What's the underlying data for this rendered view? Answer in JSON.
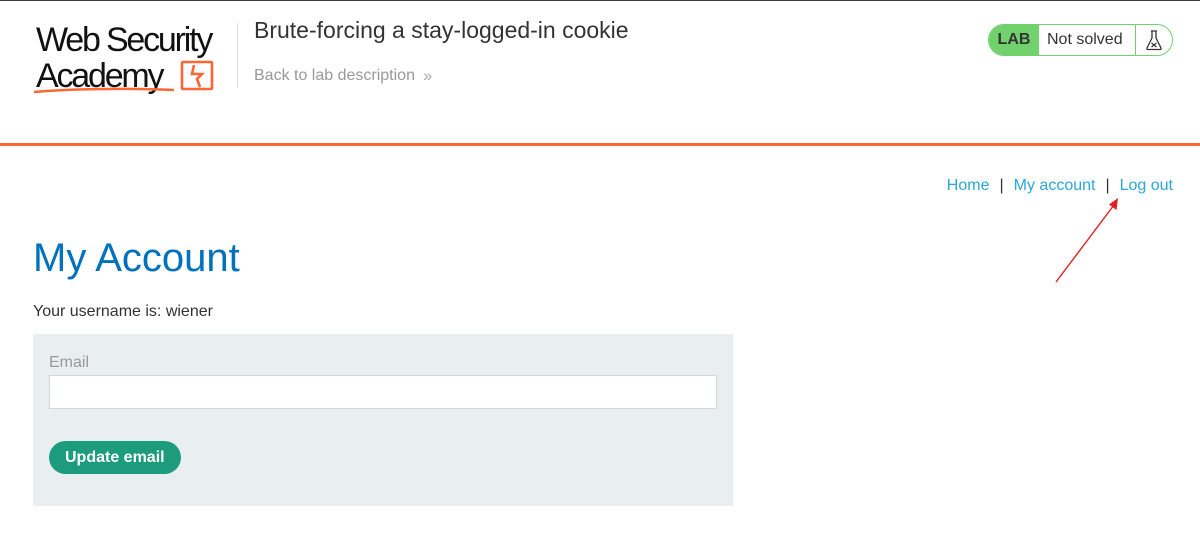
{
  "logo": {
    "line1": "Web Security",
    "line2": "Academy"
  },
  "lab": {
    "title": "Brute-forcing a stay-logged-in cookie",
    "back_link_label": "Back to lab description",
    "back_link_icon": "double-chevron-right-icon"
  },
  "status": {
    "badge": "LAB",
    "text": "Not solved",
    "icon": "flask-icon"
  },
  "nav": {
    "home": "Home",
    "separator": "|",
    "my_account": "My account",
    "log_out": "Log out"
  },
  "page": {
    "title": "My Account",
    "username_line": "Your username is: wiener"
  },
  "email_form": {
    "label": "Email",
    "value": "",
    "button_label": "Update email"
  },
  "colors": {
    "accent_orange": "#ff6633",
    "title_blue": "#0071bc",
    "link_blue": "#29a8dd",
    "status_green": "#70d16d",
    "button_green": "#1c9b7d",
    "annotation_red": "#e02020"
  }
}
